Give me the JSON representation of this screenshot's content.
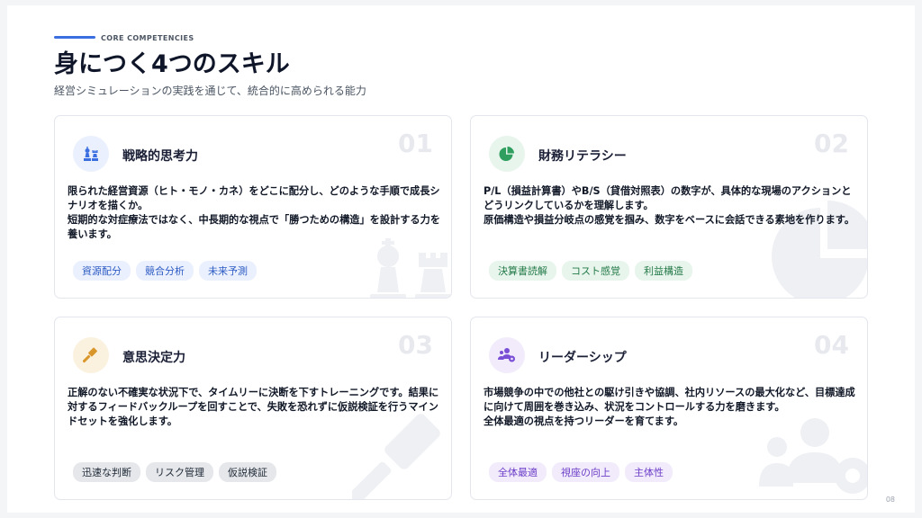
{
  "header": {
    "eyebrow": "CORE COMPETENCIES",
    "title": "身につく4つのスキル",
    "subtitle": "経営シミュレーションの実践を通じて、統合的に高められる能力"
  },
  "cards": [
    {
      "number": "01",
      "title": "戦略的思考力",
      "icon": "chess-icon",
      "accent": "#3b6fe0",
      "body": [
        "限られた経営資源（ヒト・モノ・カネ）をどこに配分し、どのような手順で成長シナリオを描くか。",
        "短期的な対症療法ではなく、中長期的な視点で「勝つための構造」を設計する力を養います。"
      ],
      "tags": [
        "資源配分",
        "競合分析",
        "未来予測"
      ]
    },
    {
      "number": "02",
      "title": "財務リテラシー",
      "icon": "pie-chart-icon",
      "accent": "#2f9e5e",
      "body": [
        "P/L（損益計算書）やB/S（貸借対照表）の数字が、具体的な現場のアクションとどうリンクしているかを理解します。",
        "原価構造や損益分岐点の感覚を掴み、数字をベースに会話できる素地を作ります。"
      ],
      "tags": [
        "決算書読解",
        "コスト感覚",
        "利益構造"
      ]
    },
    {
      "number": "03",
      "title": "意思決定力",
      "icon": "gavel-icon",
      "accent": "#d9962b",
      "body": [
        "正解のない不確実な状況下で、タイムリーに決断を下すトレーニングです。結果に対するフィードバックループを回すことで、失敗を恐れずに仮説検証を行うマインドセットを強化します。"
      ],
      "tags": [
        "迅速な判断",
        "リスク管理",
        "仮説検証"
      ]
    },
    {
      "number": "04",
      "title": "リーダーシップ",
      "icon": "team-icon",
      "accent": "#7a4fd6",
      "body": [
        "市場競争の中での他社との駆け引きや協調、社内リソースの最大化など、目標達成に向けて周囲を巻き込み、状況をコントロールする力を磨きます。",
        "全体最適の視点を持つリーダーを育てます。"
      ],
      "tags": [
        "全体最適",
        "視座の向上",
        "主体性"
      ]
    }
  ],
  "page_number": "08"
}
